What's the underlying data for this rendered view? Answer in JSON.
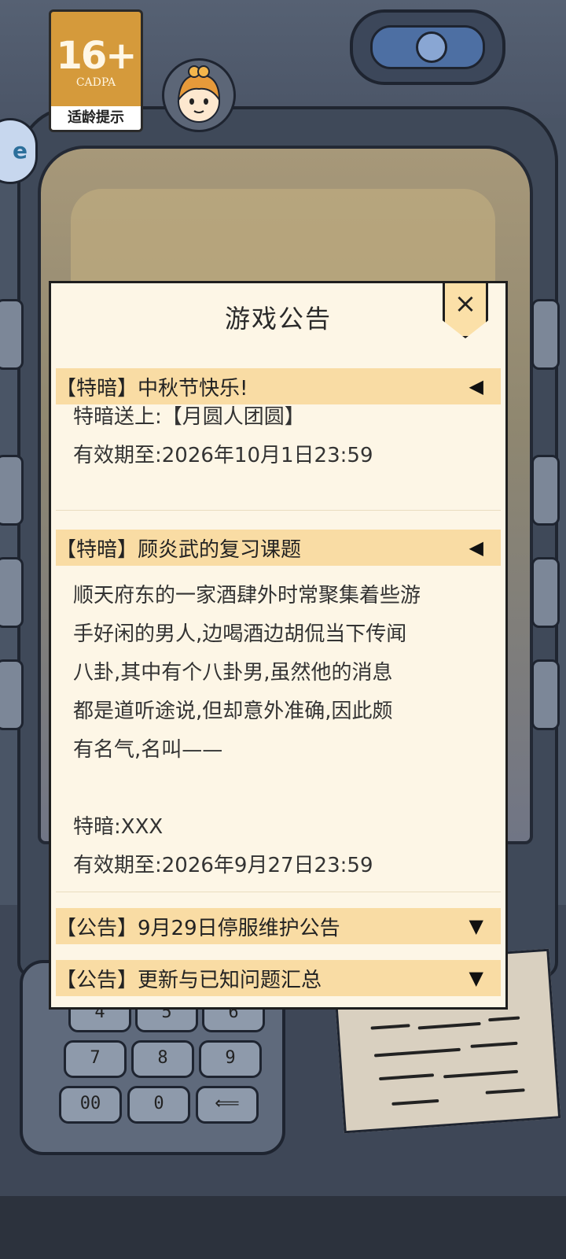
{
  "age_badge": {
    "rating": "16+",
    "org": "CADPA",
    "tip": "适龄提示"
  },
  "side_tab": {
    "glyph": "e"
  },
  "keypad": {
    "keys": [
      "4",
      "5",
      "6",
      "7",
      "8",
      "9",
      "00",
      "0",
      "⟸"
    ]
  },
  "dialog": {
    "title": "游戏公告",
    "close_icon": "×",
    "notices": [
      {
        "header": "【特暗】中秋节快乐!",
        "arrow": "◀",
        "expanded": true,
        "lines": [
          "特暗送上:【月圆人团圆】",
          "有效期至:2026年10月1日23:59"
        ]
      },
      {
        "header": "【特暗】顾炎武的复习课题",
        "arrow": "◀",
        "expanded": true,
        "paragraph_lines": [
          "顺天府东的一家酒肆外时常聚集着些游",
          "手好闲的男人,边喝酒边胡侃当下传闻",
          "八卦,其中有个八卦男,虽然他的消息",
          "都是道听途说,但却意外准确,因此颇",
          "有名气,名叫——"
        ],
        "code_line": "特暗:XXX",
        "expiry_line": "有效期至:2026年9月27日23:59"
      },
      {
        "header": "【公告】9月29日停服维护公告",
        "arrow": "▼",
        "expanded": false
      },
      {
        "header": "【公告】更新与已知问题汇总",
        "arrow": "▼",
        "expanded": false
      }
    ]
  }
}
